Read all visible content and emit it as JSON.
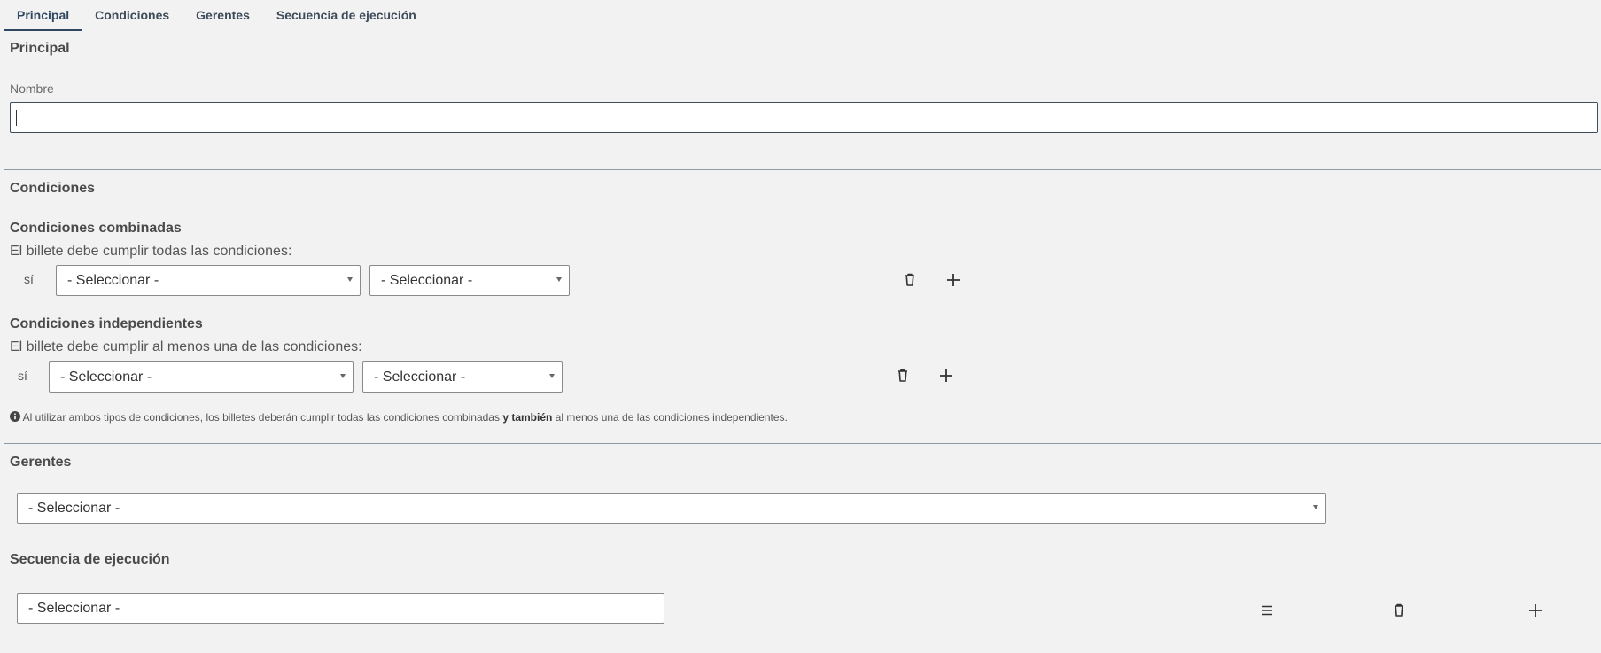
{
  "tabs": [
    {
      "label": "Principal"
    },
    {
      "label": "Condiciones"
    },
    {
      "label": "Gerentes"
    },
    {
      "label": "Secuencia de ejecución"
    }
  ],
  "principal": {
    "title": "Principal",
    "name_label": "Nombre",
    "name_value": ""
  },
  "conditions": {
    "title": "Condiciones",
    "combined": {
      "title": "Condiciones combinadas",
      "description": "El billete debe cumplir todas las condiciones:",
      "row_prefix": "sí",
      "select1": "- Seleccionar -",
      "select2": "- Seleccionar -"
    },
    "independent": {
      "title": "Condiciones independientes",
      "description": "El billete debe cumplir al menos una de las condiciones:",
      "row_prefix": "sí",
      "select1": "- Seleccionar -",
      "select2": "- Seleccionar -"
    },
    "note_part1": "Al utilizar ambos tipos de condiciones, los billetes deberán cumplir todas las condiciones combinadas",
    "note_bold": "y también",
    "note_part2": "al menos una de las condiciones independientes."
  },
  "managers": {
    "title": "Gerentes",
    "select": "- Seleccionar -"
  },
  "sequence": {
    "title": "Secuencia de ejecución",
    "select": "- Seleccionar -"
  },
  "icons": {
    "trash": "trash-icon",
    "plus": "plus-icon",
    "menu": "drag-handle-icon",
    "info": "info-icon"
  },
  "colors": {
    "background": "#f2f2f2",
    "accent": "#2f4760",
    "divider": "#8a9aa8"
  }
}
